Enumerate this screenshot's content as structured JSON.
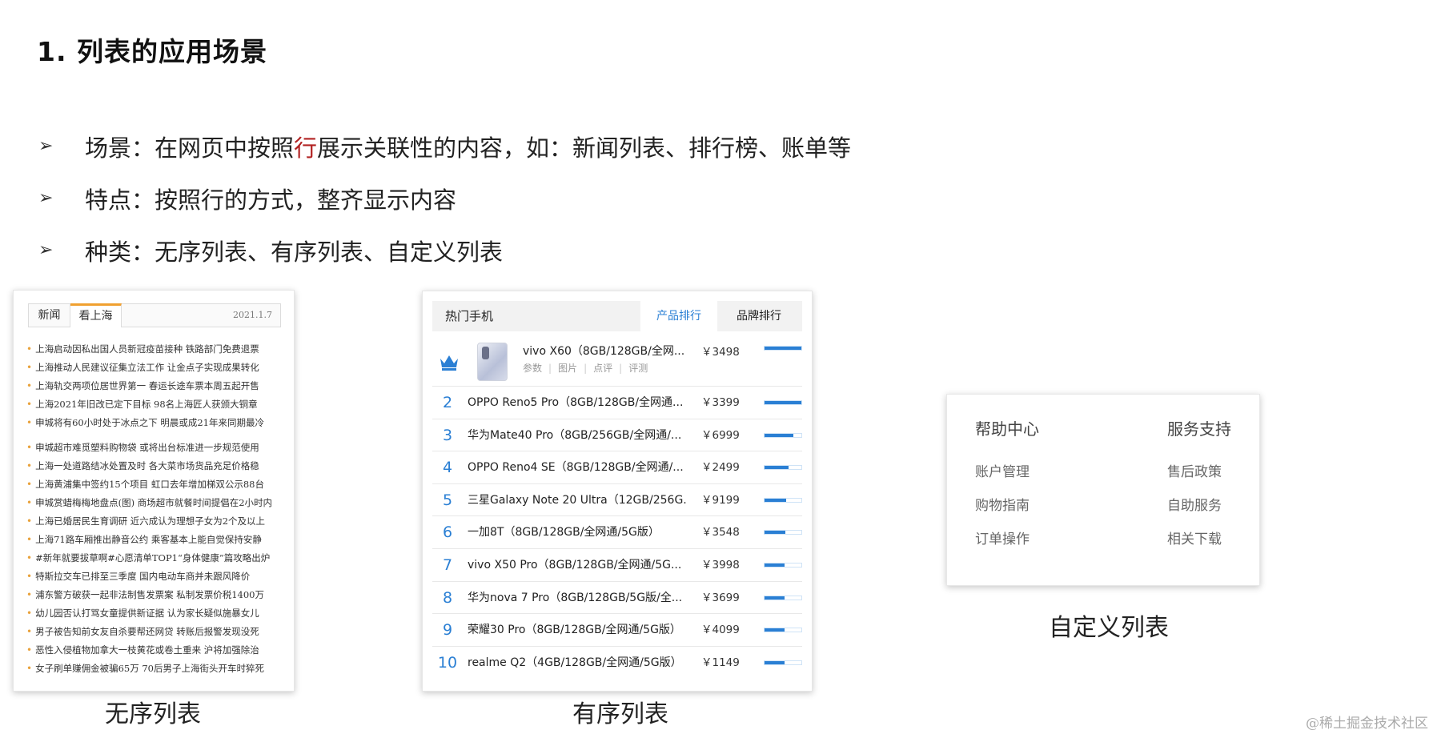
{
  "title": "1. 列表的应用场景",
  "bullets": {
    "b1": {
      "prefix": "场景：在网页中按照",
      "highlight": "行",
      "suffix": "展示关联性的内容，如：新闻列表、排行榜、账单等"
    },
    "b2": {
      "text": "特点：按照行的方式，整齐显示内容"
    },
    "b3": {
      "text": "种类：无序列表、有序列表、自定义列表"
    },
    "arrow": "➢"
  },
  "unordered": {
    "tabs": [
      "新闻",
      "看上海"
    ],
    "date": "2021.1.7",
    "bullet": "•",
    "items": [
      "上海启动因私出国人员新冠疫苗接种  铁路部门免费退票",
      "上海推动人民建议征集立法工作  让金点子实现成果转化",
      "上海轨交两项位居世界第一  春运长途车票本周五起开售",
      "上海2021年旧改已定下目标  98名上海匠人获颁大铜章",
      "申城将有60小时处于冰点之下  明晨或成21年来同期最冷",
      "申城超市难觅塑料购物袋  或将出台标准进一步规范使用",
      "上海一处道路结冰处置及时  各大菜市场货品充足价格稳",
      "上海黄浦集中签约15个项目  虹口去年增加梯双公示88台",
      "申城赏蜡梅梅地盘点(图)  商场超市就餐时间提倡在2小时内",
      "上海已婚居民生育调研  近六成认为理想子女为2个及以上",
      "上海71路车厢推出静音公约  乘客基本上能自觉保持安静",
      "#新年就要拔草啊#心愿清单TOP1“身体健康”篇攻略出炉",
      "特斯拉交车已排至三季度  国内电动车商并未跟风降价",
      "浦东警方破获一起非法制售发票案  私制发票价税1400万",
      "幼儿园否认打骂女童提供新证据  认为家长疑似施暴女儿",
      "男子被告知前女友自杀要帮还网贷  转账后报警发现没死",
      "恶性入侵植物加拿大一枝黄花或卷土重来  沪将加强除治",
      "女子刷单赚佣金被骗65万  70后男子上海街头开车时猝死"
    ]
  },
  "ordered": {
    "header": {
      "title": "热门手机",
      "tab_active": "产品排行",
      "tab_other": "品牌排行"
    },
    "top": {
      "name": "vivo X60（8GB/128GB/全网...",
      "meta": [
        "参数",
        "图片",
        "点评",
        "评测"
      ],
      "meta_sep": "|",
      "price": "￥3498",
      "popularity": 1.0
    },
    "rows": [
      {
        "rank": "2",
        "name": "OPPO Reno5 Pro（8GB/128GB/全网通...",
        "price": "￥3399",
        "popularity": 1.0
      },
      {
        "rank": "3",
        "name": "华为Mate40 Pro（8GB/256GB/全网通/...",
        "price": "￥6999",
        "popularity": 0.78
      },
      {
        "rank": "4",
        "name": "OPPO Reno4 SE（8GB/128GB/全网通/...",
        "price": "￥2499",
        "popularity": 0.66
      },
      {
        "rank": "5",
        "name": "三星Galaxy Note 20 Ultra（12GB/256G...",
        "price": "￥9199",
        "popularity": 0.58
      },
      {
        "rank": "6",
        "name": "一加8T（8GB/128GB/全网通/5G版）",
        "price": "￥3548",
        "popularity": 0.56
      },
      {
        "rank": "7",
        "name": "vivo X50 Pro（8GB/128GB/全网通/5G...",
        "price": "￥3998",
        "popularity": 0.55
      },
      {
        "rank": "8",
        "name": "华为nova 7 Pro（8GB/128GB/5G版/全...",
        "price": "￥3699",
        "popularity": 0.55
      },
      {
        "rank": "9",
        "name": "荣耀30 Pro（8GB/128GB/全网通/5G版）",
        "price": "￥4099",
        "popularity": 0.55
      },
      {
        "rank": "10",
        "name": "realme Q2（4GB/128GB/全网通/5G版）",
        "price": "￥1149",
        "popularity": 0.55
      }
    ]
  },
  "definition": {
    "col1": {
      "head": "帮助中心",
      "items": [
        "账户管理",
        "购物指南",
        "订单操作"
      ]
    },
    "col2": {
      "head": "服务支持",
      "items": [
        "售后政策",
        "自助服务",
        "相关下载"
      ]
    }
  },
  "captions": {
    "ul": "无序列表",
    "ol": "有序列表",
    "dl": "自定义列表"
  },
  "watermark": "@稀土掘金技术社区",
  "colors": {
    "highlight": "#b22222",
    "rank_blue": "#2a7fd4",
    "tab_orange": "#f0a030",
    "bullet_orange": "#e9a23b"
  },
  "icons": {
    "crown": "crown-icon",
    "arrow": "arrow-icon"
  }
}
